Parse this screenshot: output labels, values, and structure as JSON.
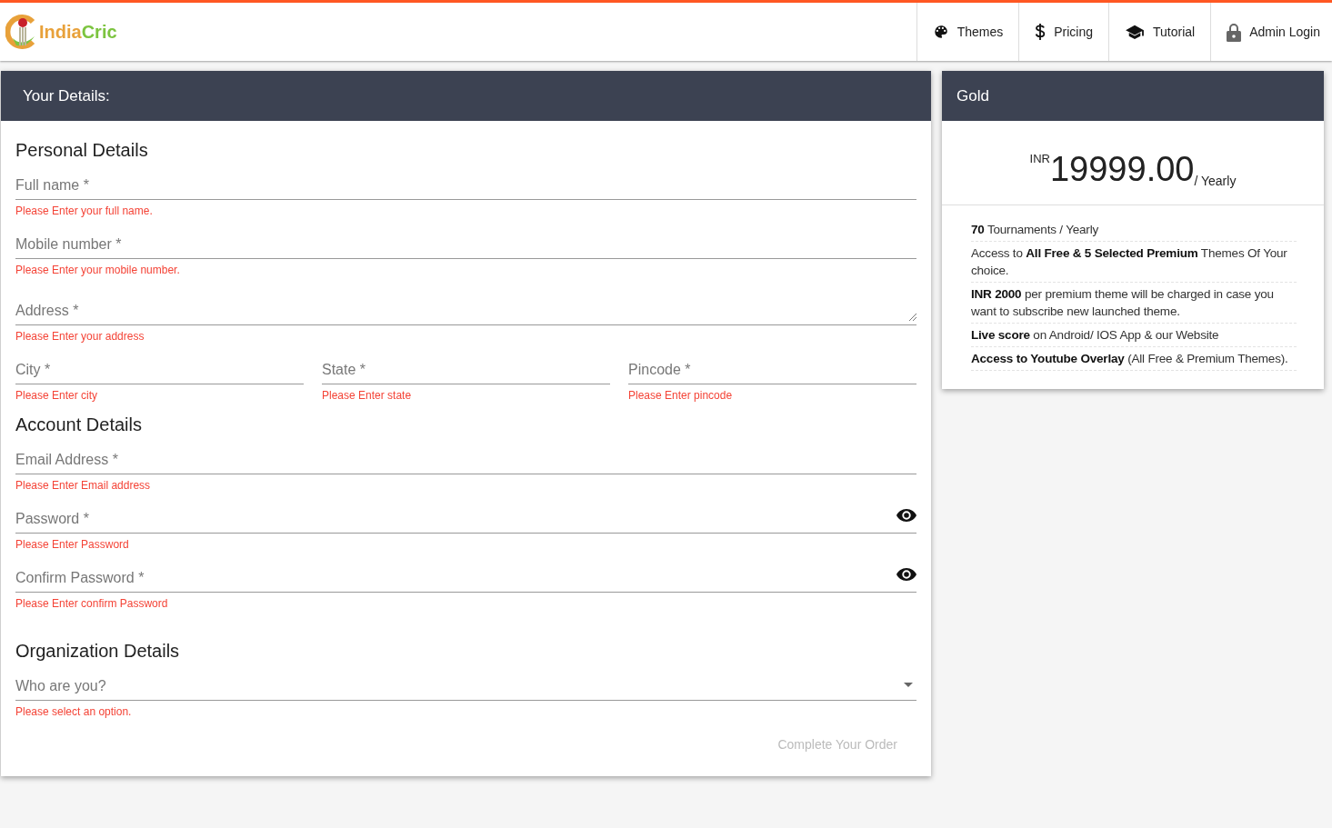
{
  "header": {
    "logo": {
      "first": "India",
      "second": "Cric"
    },
    "nav": [
      {
        "label": "Themes",
        "kind": "palette"
      },
      {
        "label": "Pricing",
        "kind": "dollar"
      },
      {
        "label": "Tutorial",
        "kind": "cap"
      },
      {
        "label": "Admin Login",
        "kind": "lock"
      }
    ]
  },
  "details_card": {
    "title": "Your Details:",
    "sections": [
      {
        "title": "Personal Details",
        "rows": [
          [
            {
              "kind": "text",
              "label": "Full name *",
              "error": "Please Enter your full name."
            }
          ],
          [
            {
              "kind": "text",
              "label": "Mobile number *",
              "error": "Please Enter your mobile number."
            }
          ],
          [
            {
              "kind": "textarea",
              "label": "Address *",
              "error": "Please Enter your address"
            }
          ],
          [
            {
              "kind": "text",
              "label": "City *",
              "error": "Please Enter city"
            },
            {
              "kind": "text",
              "label": "State *",
              "error": "Please Enter state"
            },
            {
              "kind": "text",
              "label": "Pincode *",
              "error": "Please Enter pincode"
            }
          ]
        ]
      },
      {
        "title": "Account Details",
        "rows": [
          [
            {
              "kind": "text",
              "label": "Email Address *",
              "error": "Please Enter Email address"
            }
          ],
          [
            {
              "kind": "password",
              "label": "Password *",
              "error": "Please Enter Password"
            }
          ],
          [
            {
              "kind": "password",
              "label": "Confirm Password *",
              "error": "Please Enter confirm Password"
            }
          ]
        ]
      },
      {
        "title": "Organization Details",
        "rows": [
          [
            {
              "kind": "select",
              "label": "Who are you?",
              "error": "Please select an option."
            }
          ]
        ]
      }
    ],
    "submit": {
      "label": "Complete Your Order",
      "disabled": true
    }
  },
  "plan_card": {
    "title": "Gold",
    "currency": "INR",
    "price": "19999.00",
    "period": "/ Yearly",
    "features": [
      "**70** Tournaments / Yearly",
      "Access to **All Free & 5 Selected Premium** Themes Of Your choice.",
      "**INR 2000** per premium theme will be charged in case you want to subscribe new launched theme.",
      "**Live score** on Android/ IOS App & our Website",
      "**Access to Youtube Overlay** (All Free & Premium Themes)."
    ]
  }
}
